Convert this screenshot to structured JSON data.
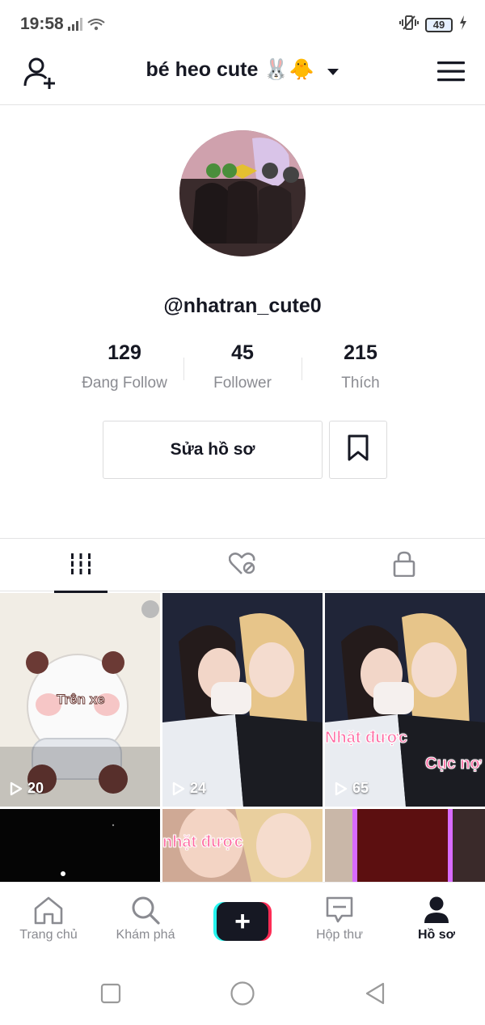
{
  "status_bar": {
    "time": "19:58",
    "battery": "49"
  },
  "header": {
    "title": "bé heo cute 🐰🐥"
  },
  "profile": {
    "username": "@nhatran_cute0",
    "stats": [
      {
        "value": "129",
        "label": "Đang Follow"
      },
      {
        "value": "45",
        "label": "Follower"
      },
      {
        "value": "215",
        "label": "Thích"
      }
    ],
    "edit_label": "Sửa hồ sơ"
  },
  "videos": [
    {
      "views": "20",
      "caption": "Trên xe"
    },
    {
      "views": "24",
      "caption": ""
    },
    {
      "views": "65",
      "caption": "Nhặt được",
      "caption2": "Cục nợ"
    },
    {
      "views": "",
      "caption": ""
    },
    {
      "views": "",
      "caption": "nhặt được"
    },
    {
      "views": "",
      "caption": ""
    }
  ],
  "bottom_nav": [
    {
      "label": "Trang chủ"
    },
    {
      "label": "Khám phá"
    },
    {
      "label": "Hộp thư"
    },
    {
      "label": "Hồ sơ"
    }
  ]
}
